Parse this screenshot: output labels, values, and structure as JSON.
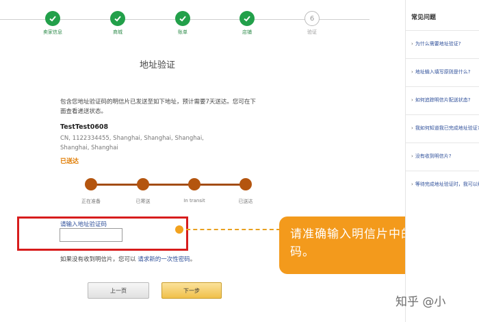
{
  "steps": [
    {
      "label": "卖家信息",
      "state": "done"
    },
    {
      "label": "商城",
      "state": "done"
    },
    {
      "label": "账单",
      "state": "done"
    },
    {
      "label": "店铺",
      "state": "done"
    },
    {
      "label": "验证",
      "state": "pending",
      "number": "6"
    }
  ],
  "page_title": "地址验证",
  "description": "包含您地址验证码的明信片已发送至如下地址，预计需要7天送达。您可在下面查看递送状态。",
  "recipient": {
    "name": "TestTest0608",
    "address": "CN, 1122334455, Shanghai, Shanghai, Shanghai, Shanghai, Shanghai"
  },
  "delivery_status": "已送达",
  "tracking": [
    "正在准备",
    "已寄送",
    "In transit",
    "已送达"
  ],
  "code_input": {
    "label": "请输入地址验证码",
    "value": "",
    "placeholder": ""
  },
  "no_card": {
    "text": "如果没有收到明信片，您可以",
    "link": "请求新的一次性密码",
    "suffix": "。"
  },
  "buttons": {
    "prev": "上一页",
    "next": "下一步"
  },
  "callout": "请准确输入明信片中的地址验证码。",
  "sidebar": {
    "title": "常见问题",
    "items": [
      "为什么需要地址验证?",
      "地址输入填写原则是什么?",
      "如何追踪明信片配送状态?",
      "我如何知道我已完成地址验证?",
      "没有收到明信片?",
      "等待完成地址验证时，我可以继续"
    ]
  },
  "watermark": "知乎 @小",
  "colors": {
    "step_done": "#22a04a",
    "track": "#a24c12",
    "highlight": "#d71c1c",
    "callout": "#f39a1c",
    "link": "#2e4f9a"
  }
}
